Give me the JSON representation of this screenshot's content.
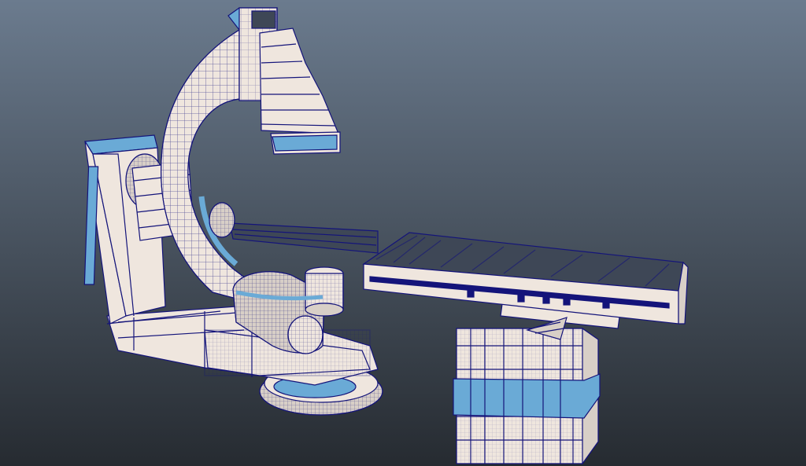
{
  "viewport": {
    "background_top": "#6b7b8e",
    "background_bottom": "#262b31"
  },
  "palette": {
    "surface": "#efe6de",
    "accent_blue": "#6aaad6",
    "wire": "#14147a",
    "tabletop": "#3e4756"
  },
  "scene": {
    "objects": [
      {
        "name": "c-arm-stand",
        "icon": "pillar-shape"
      },
      {
        "name": "c-arm-arc",
        "icon": "c-arc-shape"
      },
      {
        "name": "detector-head",
        "icon": "detector-shape"
      },
      {
        "name": "x-ray-tube",
        "icon": "cylinder-shape"
      },
      {
        "name": "floor-turntable",
        "icon": "disc-shape"
      },
      {
        "name": "patient-table",
        "icon": "slab-shape"
      },
      {
        "name": "table-pedestal",
        "icon": "box-shape"
      }
    ]
  }
}
